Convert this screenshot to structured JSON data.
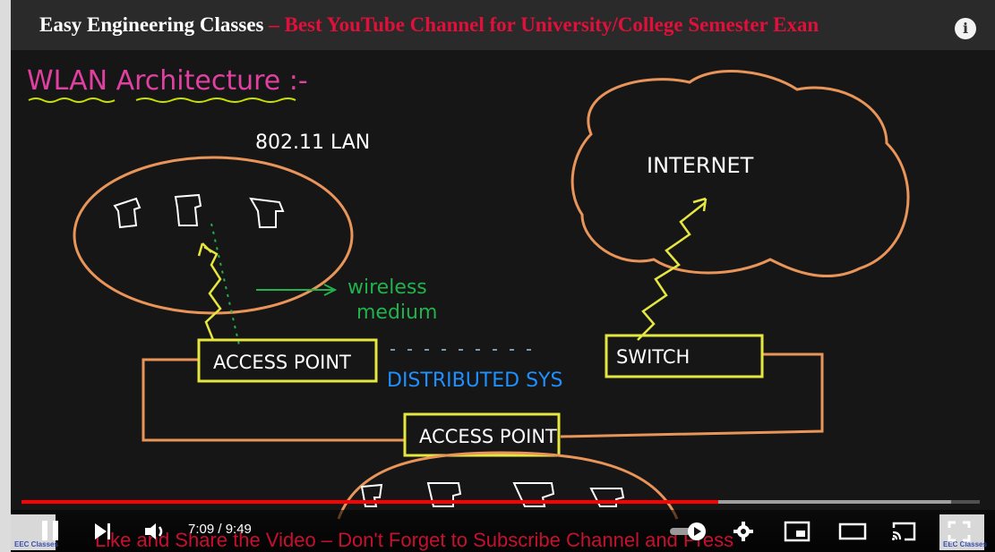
{
  "header": {
    "channel": "Easy Engineering Classes",
    "tagline": " – Best YouTube Channel for University/College Semester Exan",
    "info_icon": "i"
  },
  "board": {
    "heading": "WLAN Architecture :-",
    "lan_label": "802.11 LAN",
    "internet_label": "INTERNET",
    "wireless_label_1": "wireless",
    "wireless_label_2": "medium",
    "access_point_top": "ACCESS POINT",
    "switch_label": "SWITCH",
    "distributed_label": "DISTRIBUTED SYS",
    "access_point_bottom": "ACCESS POINT",
    "colors": {
      "heading": "#e040a0",
      "underline": "#c8e000",
      "box": "#e6e640",
      "line": "#e9955a",
      "green": "#22b14c",
      "blue": "#1e90ff"
    }
  },
  "player": {
    "scroll_banner": "Like and Share the Video – Don't Forget to Subscribe Channel and Press",
    "time": "7:09 / 9:49",
    "progress": {
      "played_fraction": 0.7275,
      "buffered_fraction": 0.97
    },
    "logo_text": "EEC Classes",
    "icons": [
      "pause-icon",
      "next-icon",
      "volume-icon",
      "autoplay-toggle",
      "settings-icon",
      "miniplayer-icon",
      "theater-icon",
      "cast-icon",
      "fullscreen-icon"
    ],
    "accent": "#ff0000"
  }
}
